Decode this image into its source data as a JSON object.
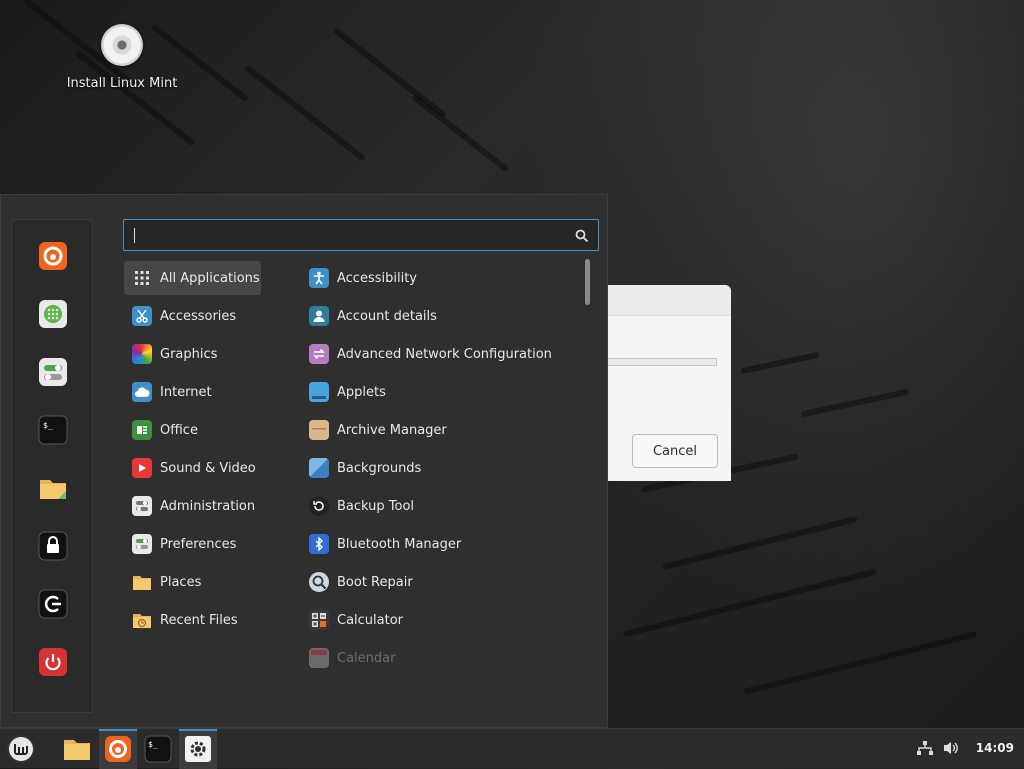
{
  "desktop": {
    "icon_label": "Install Linux Mint",
    "icon": "cdrom-icon"
  },
  "dialog": {
    "cancel_label": "Cancel"
  },
  "menu": {
    "search": {
      "value": "",
      "placeholder": ""
    },
    "favorites": [
      {
        "name": "firefox",
        "icon": "firefox-icon"
      },
      {
        "name": "software-manager",
        "icon": "software-manager-icon"
      },
      {
        "name": "system-settings",
        "icon": "settings-toggles-icon"
      },
      {
        "name": "terminal",
        "icon": "terminal-icon"
      },
      {
        "name": "files",
        "icon": "folder-icon"
      },
      {
        "name": "lock-screen",
        "icon": "lock-icon"
      },
      {
        "name": "logout",
        "icon": "logout-icon"
      },
      {
        "name": "shutdown",
        "icon": "power-icon"
      }
    ],
    "categories": [
      {
        "label": "All Applications",
        "icon": "grid-icon",
        "selected": true
      },
      {
        "label": "Accessories",
        "icon": "scissors-icon"
      },
      {
        "label": "Graphics",
        "icon": "graphics-icon"
      },
      {
        "label": "Internet",
        "icon": "cloud-icon"
      },
      {
        "label": "Office",
        "icon": "office-icon"
      },
      {
        "label": "Sound & Video",
        "icon": "play-icon"
      },
      {
        "label": "Administration",
        "icon": "admin-toggles-icon"
      },
      {
        "label": "Preferences",
        "icon": "preferences-toggles-icon"
      },
      {
        "label": "Places",
        "icon": "folder-icon"
      },
      {
        "label": "Recent Files",
        "icon": "recent-folder-icon"
      }
    ],
    "apps": [
      {
        "label": "Accessibility",
        "icon": "accessibility-icon"
      },
      {
        "label": "Account details",
        "icon": "account-icon"
      },
      {
        "label": "Advanced Network Configuration",
        "icon": "network-arrows-icon"
      },
      {
        "label": "Applets",
        "icon": "applets-icon"
      },
      {
        "label": "Archive Manager",
        "icon": "archive-icon"
      },
      {
        "label": "Backgrounds",
        "icon": "backgrounds-icon"
      },
      {
        "label": "Backup Tool",
        "icon": "backup-icon"
      },
      {
        "label": "Bluetooth Manager",
        "icon": "bluetooth-icon"
      },
      {
        "label": "Boot Repair",
        "icon": "boot-repair-icon"
      },
      {
        "label": "Calculator",
        "icon": "calculator-icon"
      },
      {
        "label": "Calendar",
        "icon": "calendar-icon",
        "dimmed": true
      }
    ]
  },
  "taskbar": {
    "items": [
      {
        "name": "menu",
        "icon": "mint-logo-icon"
      },
      {
        "name": "files",
        "icon": "folder-icon"
      },
      {
        "name": "firefox",
        "icon": "firefox-icon",
        "active": true
      },
      {
        "name": "terminal",
        "icon": "terminal-icon"
      },
      {
        "name": "settings",
        "icon": "gear-icon",
        "active": true
      }
    ],
    "tray": {
      "network_icon": "network-icon",
      "volume_icon": "volume-icon"
    },
    "clock": "14:09"
  },
  "colors": {
    "accent": "#3e90c9",
    "panel": "#2f2f2f",
    "power_red": "#d63434",
    "firefox_orange": "#f0641f"
  }
}
